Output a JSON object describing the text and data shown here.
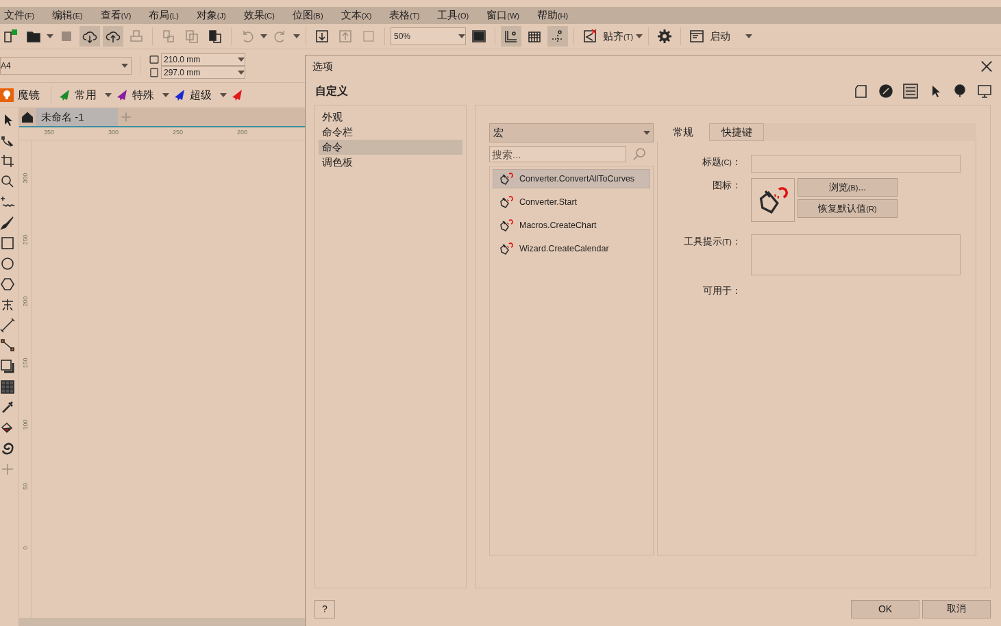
{
  "menu": [
    {
      "label": "文件",
      "key": "(F)"
    },
    {
      "label": "编辑",
      "key": "(E)"
    },
    {
      "label": "查看",
      "key": "(V)"
    },
    {
      "label": "布局",
      "key": "(L)"
    },
    {
      "label": "对象",
      "key": "(J)"
    },
    {
      "label": "效果",
      "key": "(C)"
    },
    {
      "label": "位图",
      "key": "(B)"
    },
    {
      "label": "文本",
      "key": "(X)"
    },
    {
      "label": "表格",
      "key": "(T)"
    },
    {
      "label": "工具",
      "key": "(O)"
    },
    {
      "label": "窗口",
      "key": "(W)"
    },
    {
      "label": "帮助",
      "key": "(H)"
    }
  ],
  "toolbar": {
    "zoom": "50%",
    "snap": {
      "label": "贴齐",
      "key": "(T)"
    },
    "launch": "启动"
  },
  "property_bar": {
    "page_size": "A4",
    "width": "210.0 mm",
    "height": "297.0 mm"
  },
  "macro_bar": [
    {
      "label": "魔镜",
      "color": "#e8620c"
    },
    {
      "label": "常用",
      "color": "#1a8a2a"
    },
    {
      "label": "特殊",
      "color": "#8a1aa0"
    },
    {
      "label": "超级",
      "color": "#1a2ad0"
    },
    {
      "color": "#e01818"
    }
  ],
  "document_tabs": [
    {
      "label": "未命名 -1",
      "selected": true
    }
  ],
  "ruler": {
    "horizontal": [
      "350",
      "300",
      "250",
      "200"
    ],
    "vertical": [
      "300",
      "250",
      "200",
      "150",
      "100",
      "50",
      "0"
    ]
  },
  "dialog": {
    "title": "选项",
    "heading": "自定义",
    "nav": [
      {
        "label": "外观",
        "selected": false
      },
      {
        "label": "命令栏",
        "selected": false
      },
      {
        "label": "命令",
        "selected": true
      },
      {
        "label": "调色板",
        "selected": false
      }
    ],
    "category": "宏",
    "search": {
      "placeholder": "搜索..."
    },
    "commands": [
      {
        "label": "Converter.ConvertAllToCurves",
        "selected": true
      },
      {
        "label": "Converter.Start",
        "selected": false
      },
      {
        "label": "Macros.CreateChart",
        "selected": false
      },
      {
        "label": "Wizard.CreateCalendar",
        "selected": false
      }
    ],
    "tabs": [
      {
        "label": "常规",
        "selected": true
      },
      {
        "label": "快捷键",
        "selected": false
      }
    ],
    "form": {
      "caption": {
        "label": "标题",
        "key": "(C)",
        "suffix": "："
      },
      "icon": {
        "label": "图标："
      },
      "tooltip": {
        "label": "工具提示",
        "key": "(T)",
        "suffix": "："
      },
      "available": {
        "label": "可用于："
      }
    },
    "icon_buttons": [
      {
        "label": "浏览",
        "key": "(B)",
        "suffix": "..."
      },
      {
        "label": "恢复默认值",
        "key": "(R)"
      }
    ],
    "help": "?",
    "ok": "OK",
    "cancel": "取消"
  }
}
